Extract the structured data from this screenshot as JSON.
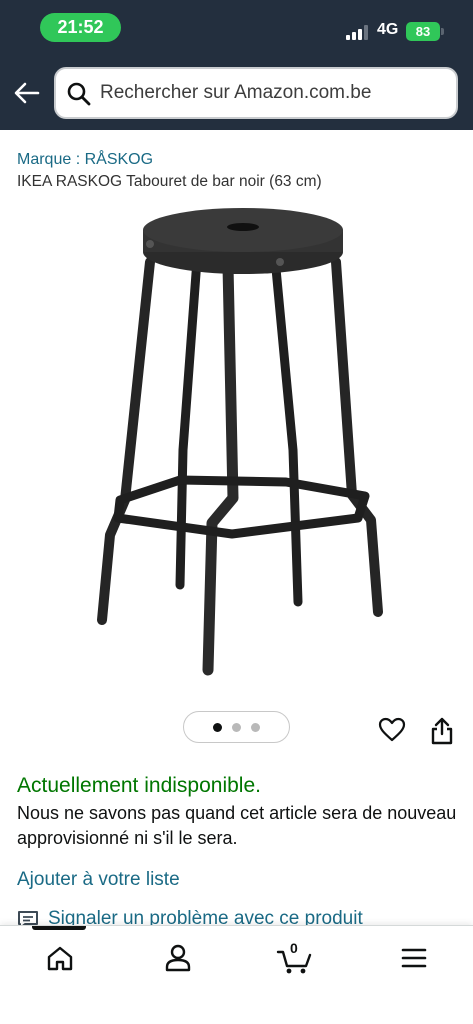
{
  "status_bar": {
    "time": "21:52",
    "network": "4G",
    "battery": "83"
  },
  "search": {
    "placeholder": "Rechercher sur Amazon.com.be"
  },
  "product": {
    "brand_link": "Marque : RÅSKOG",
    "title": "IKEA RASKOG Tabouret de bar noir (63 cm)",
    "image_count": 3,
    "active_image": 1
  },
  "availability": {
    "status": "Actuellement indisponible.",
    "description": "Nous ne savons pas quand cet article sera de nouveau approvisionné ni s'il le sera."
  },
  "actions": {
    "add_to_list": "Ajouter à votre liste",
    "report": "Signaler un problème avec ce produit"
  },
  "bottom_nav": {
    "cart_count": "0",
    "items": [
      "home-icon",
      "account-icon",
      "cart-icon",
      "menu-icon"
    ]
  },
  "colors": {
    "header_bg": "#232f3e",
    "link": "#1a6a85",
    "availability": "#007600",
    "status_green": "#30c759"
  }
}
